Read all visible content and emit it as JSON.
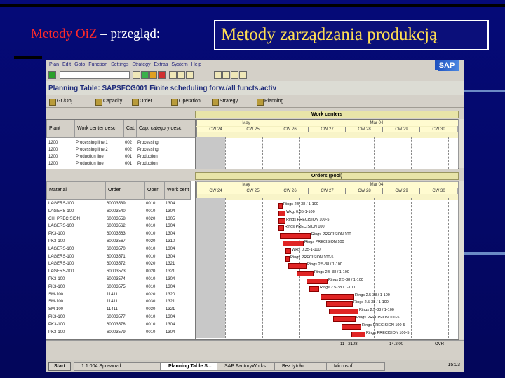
{
  "slide": {
    "title_red": "Metody OiZ",
    "title_rest": " – przegląd:",
    "boxed_title": "Metody zarządzania produkcją"
  },
  "sap": {
    "menu": [
      "Plan",
      "Edit",
      "Goto",
      "Function",
      "Settings",
      "Strategy",
      "Extras",
      "System",
      "Help"
    ],
    "logo": "SAP",
    "window_title": "Planning Table: SAPSFCG001 Finite scheduling forw./all functs.activ",
    "toolbar_buttons": [
      "Gr./Obj",
      "Capacity",
      "Order",
      "Operation",
      "Strategy",
      "Planning"
    ],
    "work_centers_header": "Work centers",
    "orders_header": "Orders (pool)",
    "wc_columns": [
      "Plant",
      "Work center desc.",
      "Cat.",
      "Cap. category desc."
    ],
    "order_columns": [
      "Material",
      "Order",
      "Oper",
      "Work cent"
    ],
    "timeline_top": [
      "May",
      "Mar 04"
    ],
    "timeline_days": [
      "CW 24",
      "CW 25",
      "CW 26",
      "CW 27",
      "CW 28",
      "CW 29",
      "CW 30"
    ],
    "wc_rows": [
      [
        "1200",
        "Processing line 1",
        "002",
        "Processing"
      ],
      [
        "1200",
        "Processing line 2",
        "002",
        "Processing"
      ],
      [
        "1200",
        "Production line",
        "001",
        "Production"
      ],
      [
        "1200",
        "Production line",
        "001",
        "Production"
      ]
    ],
    "order_rows": [
      {
        "material": "LAGERS-100",
        "order": "60003539",
        "oper": "0010",
        "wc": "1304"
      },
      {
        "material": "LAGERS-100",
        "order": "60003540",
        "oper": "0010",
        "wc": "1304"
      },
      {
        "material": "CH. PRECISION",
        "order": "60003558",
        "oper": "0020",
        "wc": "1305"
      },
      {
        "material": "LAGERS-100",
        "order": "60003562",
        "oper": "0010",
        "wc": "1304"
      },
      {
        "material": "PK3-100",
        "order": "60003563",
        "oper": "0010",
        "wc": "1304"
      },
      {
        "material": "PK3-100",
        "order": "60003567",
        "oper": "0020",
        "wc": "1310"
      },
      {
        "material": "LAGERS-100",
        "order": "60003570",
        "oper": "0010",
        "wc": "1304"
      },
      {
        "material": "LAGERS-100",
        "order": "60003571",
        "oper": "0010",
        "wc": "1304"
      },
      {
        "material": "LAGERS-100",
        "order": "60003572",
        "oper": "0020",
        "wc": "1321"
      },
      {
        "material": "LAGERS-100",
        "order": "60003573",
        "oper": "0020",
        "wc": "1321"
      },
      {
        "material": "PK3-100",
        "order": "60003574",
        "oper": "0010",
        "wc": "1304"
      },
      {
        "material": "PK3-100",
        "order": "60003575",
        "oper": "0010",
        "wc": "1304"
      },
      {
        "material": "SM-100",
        "order": "11411",
        "oper": "0020",
        "wc": "1320"
      },
      {
        "material": "SM-100",
        "order": "11411",
        "oper": "0030",
        "wc": "1321"
      },
      {
        "material": "SM-100",
        "order": "11411",
        "oper": "0030",
        "wc": "1321"
      },
      {
        "material": "PK3-100",
        "order": "60003577",
        "oper": "0010",
        "wc": "1304"
      },
      {
        "material": "PK3-100",
        "order": "60003578",
        "oper": "0010",
        "wc": "1304"
      },
      {
        "material": "PK3-100",
        "order": "60003579",
        "oper": "0010",
        "wc": "1304"
      }
    ],
    "bar_labels": [
      "Rings 2.5-38 / 1-100",
      "Wkg. 0.35-1-100",
      "Rings PRECISION 100-5",
      "Rings PRECISION 100",
      "Rings PRECISION 100",
      "Rings PRECISION 100",
      "Wkg. 0.35-1-100",
      "Rings PRECISION 100-5",
      "Rings 2.5-38 / 1-100",
      "Rings 2.5-38 / 1-100",
      "Rings 2.5-38 / 1-100",
      "Rings 2.5-38 / 1-100",
      "Rings 2.5-38 / 1-100",
      "Rings 2.5-38 / 1-100",
      "Rings 2.5-38 / 1-100",
      "Rings PRECISION 100-5",
      "Rings PRECISION 100-5",
      "Rings PRECISION 100-5"
    ],
    "status_left": "11 : 2108",
    "status_mid": "14.2:00",
    "status_right": "OVR",
    "taskbar": {
      "start": "Start",
      "tasks": [
        "1.1 004 Sprawozd.",
        "Planning Table S...",
        "SAP FactoryWorks...",
        "Bez tytułu...",
        "Microsoft..."
      ],
      "clock": "15:03"
    },
    "colors": {
      "bar": "#e02424",
      "header": "#e8e4a8"
    }
  }
}
